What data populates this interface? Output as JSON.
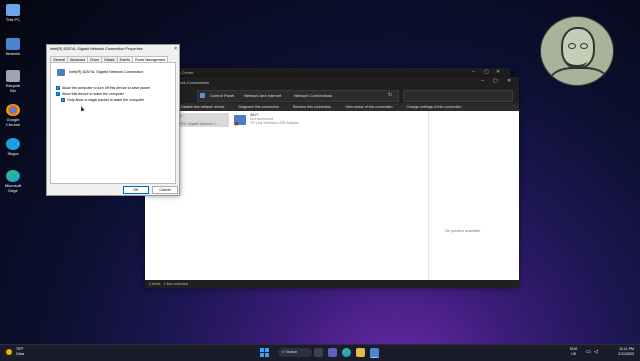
{
  "desktop": {
    "icons": [
      {
        "label": "This PC",
        "color": "#6aa6e8"
      },
      {
        "label": "Network",
        "color": "#4a86d0"
      },
      {
        "label": "Recycle Bin",
        "color": "#9aa4b4"
      },
      {
        "label": "Google Chrome",
        "color": "#e0463a"
      },
      {
        "label": "Skype",
        "color": "#1ba1e2"
      },
      {
        "label": "Microsoft Edge",
        "color": "#1b9be0"
      }
    ]
  },
  "explorer": {
    "title": "Network Connections",
    "title_fragment": "ng Center",
    "breadcrumb": [
      "Control Panel",
      "Network and Internet",
      "Network Connections"
    ],
    "search_placeholder": "",
    "commands": [
      "Disable this network device",
      "Diagnose this connection",
      "Rename this connection",
      "View status of this connection",
      "Change settings of this connection"
    ],
    "selected_item": {
      "name": "rnet",
      "status": "rk",
      "adapter": "82574L Gigabit Network C..."
    },
    "wifi_item": {
      "name": "Wi-Fi",
      "status": "Not connected",
      "adapter": "TP-Link Wireless USB Adapter"
    },
    "preview_text": "No preview available.",
    "status_text": "2 items   1 item selected"
  },
  "dialog": {
    "title": "Intel(R) 82574L Gigabit Network Connection Properties",
    "close": "×",
    "tabs": [
      "General",
      "Advanced",
      "Driver",
      "Details",
      "Events",
      "Power Management"
    ],
    "active_tab": "Power Management",
    "adapter_name": "Intel(R) 82574L Gigabit Network Connection",
    "options": [
      {
        "label": "Allow the computer to turn off this device to save power",
        "checked": true
      },
      {
        "label": "Allow this device to wake the computer",
        "checked": true
      },
      {
        "label": "Only allow a magic packet to wake the computer",
        "checked": true
      }
    ],
    "ok_label": "OK",
    "cancel_label": "Cancel"
  },
  "taskbar": {
    "weather_temp": "78°F",
    "weather_desc": "Clear",
    "search_label": "Search",
    "lang_top": "ENG",
    "lang_bottom": "US",
    "time": "11:11 PM",
    "date": "2/11/2023"
  }
}
